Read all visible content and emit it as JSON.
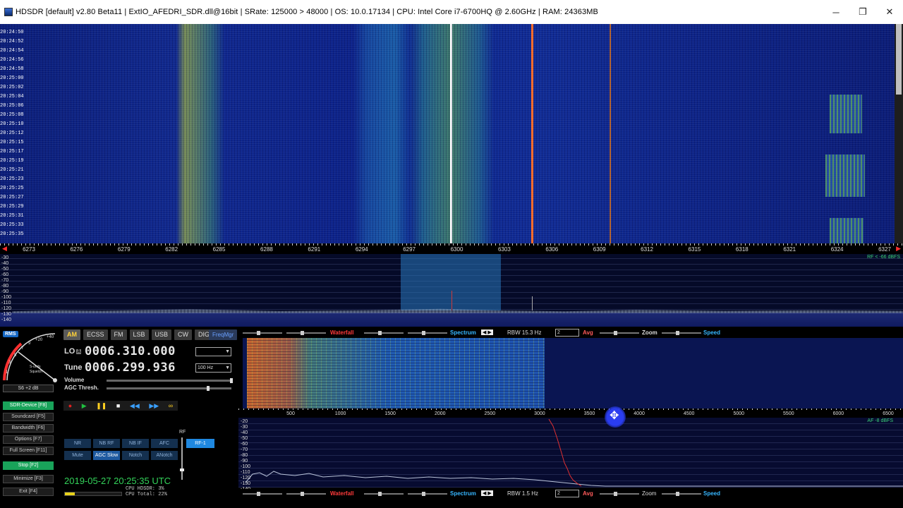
{
  "titlebar": {
    "title": "HDSDR  [default]  v2.80 Beta11  |  ExtIO_AFEDRI_SDR.dll@16bit  |  SRate: 125000 > 48000  |  OS: 10.0.17134  |  CPU: Intel Core i7-6700HQ @ 2.60GHz  |  RAM: 24363MB",
    "minimize": "─",
    "maximize": "❐",
    "close": "✕"
  },
  "waterfall": {
    "times": [
      "20:24:50",
      "20:24:52",
      "20:24:54",
      "20:24:56",
      "20:24:58",
      "20:25:00",
      "20:25:02",
      "20:25:04",
      "20:25:06",
      "20:25:08",
      "20:25:10",
      "20:25:12",
      "20:25:15",
      "20:25:17",
      "20:25:19",
      "20:25:21",
      "20:25:23",
      "20:25:25",
      "20:25:27",
      "20:25:29",
      "20:25:31",
      "20:25:33",
      "20:25:35"
    ]
  },
  "freq_axis": {
    "ticks": [
      "6273",
      "6276",
      "6279",
      "6282",
      "6285",
      "6288",
      "6291",
      "6294",
      "6297",
      "6300",
      "6303",
      "6306",
      "6309",
      "6312",
      "6315",
      "6318",
      "6321",
      "6324",
      "6327"
    ]
  },
  "main_spectrum": {
    "db_labels": [
      "-30",
      "-40",
      "-50",
      "-60",
      "-70",
      "-80",
      "-90",
      "-100",
      "-110",
      "-120",
      "-130",
      "-140"
    ],
    "rf_level": "RF < -66 dBFS"
  },
  "smeter": {
    "rms": "RMS",
    "value": "S6 +2 dB",
    "scale": [
      "1",
      "3",
      "5",
      "7",
      "9",
      "+20",
      "+40"
    ],
    "squelch": "S-units Squelch"
  },
  "modes": [
    {
      "label": "AM",
      "active": true
    },
    {
      "label": "ECSS",
      "active": false
    },
    {
      "label": "FM",
      "active": false
    },
    {
      "label": "LSB",
      "active": false
    },
    {
      "label": "USB",
      "active": false
    },
    {
      "label": "CW",
      "active": false
    },
    {
      "label": "DIG",
      "active": false
    }
  ],
  "freqmgr": "FreqMgr",
  "lo": {
    "label": "LO",
    "badge": "A",
    "freq": "0006.310.000",
    "combo": ""
  },
  "tune": {
    "label": "Tune",
    "freq": "0006.299.936",
    "step": "100 Hz"
  },
  "volume": {
    "label": "Volume",
    "level": 0.99
  },
  "agc": {
    "label": "AGC Thresh.",
    "level": 0.8
  },
  "side_buttons": [
    {
      "label": "SDR-Device [F8]",
      "green": true
    },
    {
      "label": "Soundcard [F5]",
      "green": false
    },
    {
      "label": "Bandwidth [F6]",
      "green": false
    },
    {
      "label": "Options [F7]",
      "green": false
    },
    {
      "label": "Full Screen [F11]",
      "green": false
    },
    {
      "label": "Stop [F2]",
      "green": true
    },
    {
      "label": "Minimize [F3]",
      "green": false
    },
    {
      "label": "Exit [F4]",
      "green": false
    }
  ],
  "transport": [
    "●",
    "▶",
    "❚❚",
    "■",
    "◀◀",
    "▶▶",
    "∞"
  ],
  "dsp_row1": [
    "NR",
    "NB RF",
    "NB IF",
    "AFC"
  ],
  "dsp_row2": [
    "Mute",
    "AGC Slow",
    "Notch",
    "ANotch"
  ],
  "rf1": "RF-1",
  "rf_label": "RF",
  "datetime": "2019-05-27  20:25:35 UTC",
  "cpu": {
    "hdsdr": "CPU HDSDR:  3%",
    "total": "CPU Total: 22%",
    "load": 0.18
  },
  "ctrlbar_top": {
    "waterfall": "Waterfall",
    "spectrum": "Spectrum",
    "rbw": "RBW 15.3 Hz",
    "avg_combo": "2",
    "avg": "Avg",
    "zoom": "Zoom",
    "speed": "Speed"
  },
  "ctrlbar_bottom": {
    "waterfall": "Waterfall",
    "spectrum": "Spectrum",
    "rbw": "RBW  1.5 Hz",
    "avg_combo": "2",
    "avg": "Avg",
    "zoom": "Zoom",
    "speed": "Speed"
  },
  "audio_axis": {
    "ticks": [
      "500",
      "1000",
      "1500",
      "2000",
      "2500",
      "3000",
      "3500",
      "4000",
      "4500",
      "5000",
      "5500",
      "6000",
      "6500"
    ]
  },
  "audio_spectrum": {
    "db_labels": [
      "-20",
      "-30",
      "-40",
      "-50",
      "-60",
      "-70",
      "-80",
      "-90",
      "-100",
      "-110",
      "-120",
      "-130",
      "-140"
    ],
    "af_level": "AF -8 dBFS"
  },
  "colors": {
    "accent_green": "#3cd27a",
    "accent_red": "#ff3a3a",
    "accent_cyan": "#36b6ff",
    "mode_active": "#ffd23a"
  }
}
